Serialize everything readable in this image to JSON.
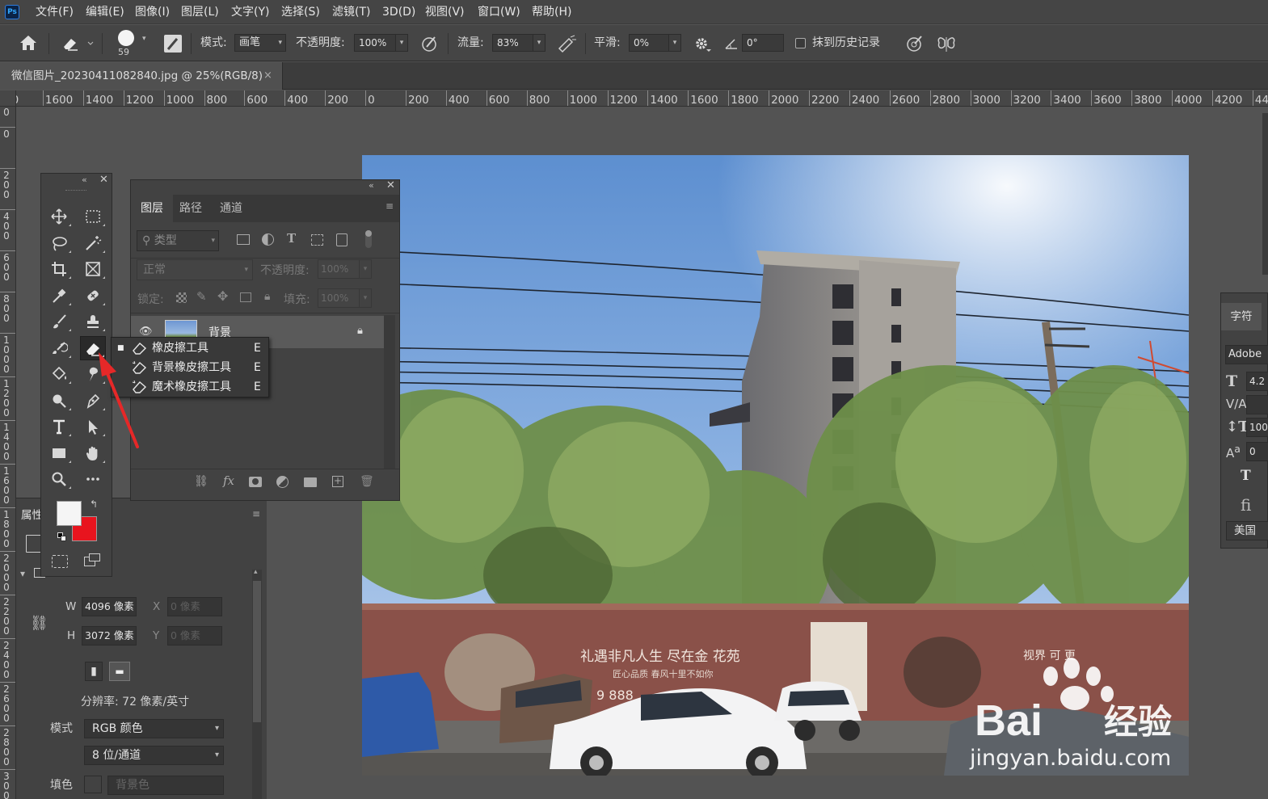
{
  "app": {
    "logo": "Ps"
  },
  "menu": [
    "文件(F)",
    "编辑(E)",
    "图像(I)",
    "图层(L)",
    "文字(Y)",
    "选择(S)",
    "滤镜(T)",
    "3D(D)",
    "视图(V)",
    "窗口(W)",
    "帮助(H)"
  ],
  "options": {
    "brush_size": "59",
    "mode_label": "模式:",
    "mode_value": "画笔",
    "opacity_label": "不透明度:",
    "opacity_value": "100%",
    "flow_label": "流量:",
    "flow_value": "83%",
    "smooth_label": "平滑:",
    "smooth_value": "0%",
    "angle_value": "0°",
    "history_label": "抹到历史记录"
  },
  "document_tab": {
    "title": "微信图片_20230411082840.jpg @ 25%(RGB/8)"
  },
  "ruler": {
    "h_labels": [
      "00",
      "1600",
      "1400",
      "1200",
      "1000",
      "800",
      "600",
      "400",
      "200",
      "0",
      "200",
      "400",
      "600",
      "800",
      "1000",
      "1200",
      "1400",
      "1600",
      "1800",
      "2000",
      "2200",
      "2400",
      "2600",
      "2800",
      "3000",
      "3200",
      "3400",
      "3600",
      "3800",
      "4000",
      "4200",
      "44"
    ],
    "v_labels": [
      "200",
      "0",
      "200",
      "400",
      "600",
      "800",
      "1000",
      "1200",
      "1400",
      "1600",
      "1800",
      "2000",
      "2200",
      "2400",
      "2600",
      "2800",
      "3000"
    ]
  },
  "layers_panel": {
    "tabs": [
      "图层",
      "路径",
      "通道"
    ],
    "filter_placeholder": "类型",
    "blend_mode": "正常",
    "opacity_label": "不透明度:",
    "opacity_value": "100%",
    "lock_label": "锁定:",
    "fill_label": "填充:",
    "fill_value": "100%",
    "layers": [
      {
        "name": "背景",
        "locked": true,
        "visible": true
      }
    ]
  },
  "tool_flyout": {
    "items": [
      {
        "label": "橡皮擦工具",
        "shortcut": "E",
        "selected": true
      },
      {
        "label": "背景橡皮擦工具",
        "shortcut": "E",
        "selected": false
      },
      {
        "label": "魔术橡皮擦工具",
        "shortcut": "E",
        "selected": false
      }
    ]
  },
  "colors": {
    "foreground": "#f5f5f5",
    "background": "#e8141e",
    "accent": "#31a8ff",
    "annotation_arrow": "#e62828"
  },
  "properties_panel": {
    "title": "属性",
    "w_label": "W",
    "w_value": "4096 像素",
    "h_label": "H",
    "h_value": "3072 像素",
    "x_label": "X",
    "x_value": "0 像素",
    "y_label": "Y",
    "y_value": "0 像素",
    "resolution": "分辨率: 72 像素/英寸",
    "mode_label": "模式",
    "mode_value": "RGB 颜色",
    "depth_value": "8 位/通道",
    "fill_label": "填色",
    "fill_value": "背景色"
  },
  "character_panel": {
    "title": "字符",
    "font": "Adobe",
    "size": "4.2",
    "tracking": "100",
    "baseline": "0",
    "language": "美国"
  },
  "photo": {
    "banner_text": "礼遇非凡人生 尽在金  花苑",
    "banner_sub": "匠心品质 春风十里不如你",
    "phone": "9 888",
    "right_banner": "视界     可    更"
  },
  "watermark": {
    "brand": "Bai",
    "brand2": "经验",
    "url": "jingyan.baidu.com"
  }
}
